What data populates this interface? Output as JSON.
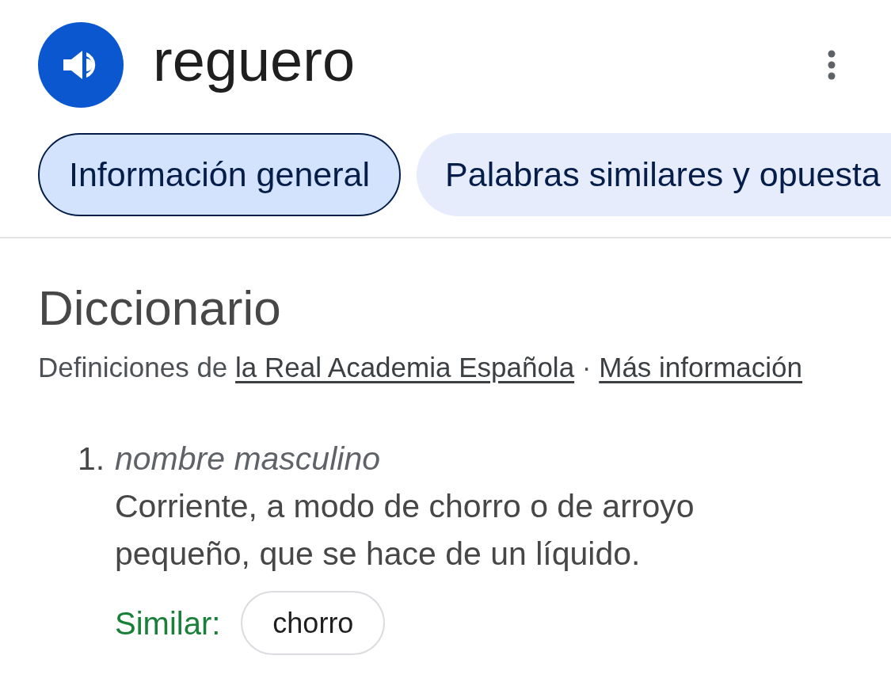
{
  "header": {
    "word": "reguero"
  },
  "tabs": [
    {
      "label": "Información general",
      "selected": true
    },
    {
      "label": "Palabras similares y opuesta",
      "selected": false
    }
  ],
  "dictionary": {
    "title": "Diccionario",
    "source_prefix": "Definiciones de",
    "source_link": "la Real Academia Española",
    "separator": "·",
    "more_link": "Más información"
  },
  "senses": [
    {
      "number": "1.",
      "part_of_speech": "nombre masculino",
      "definition": "Corriente, a modo de chorro o de arroyo pequeño, que se hace de un líquido.",
      "similar_label": "Similar:",
      "similar": [
        "chorro"
      ]
    }
  ]
}
